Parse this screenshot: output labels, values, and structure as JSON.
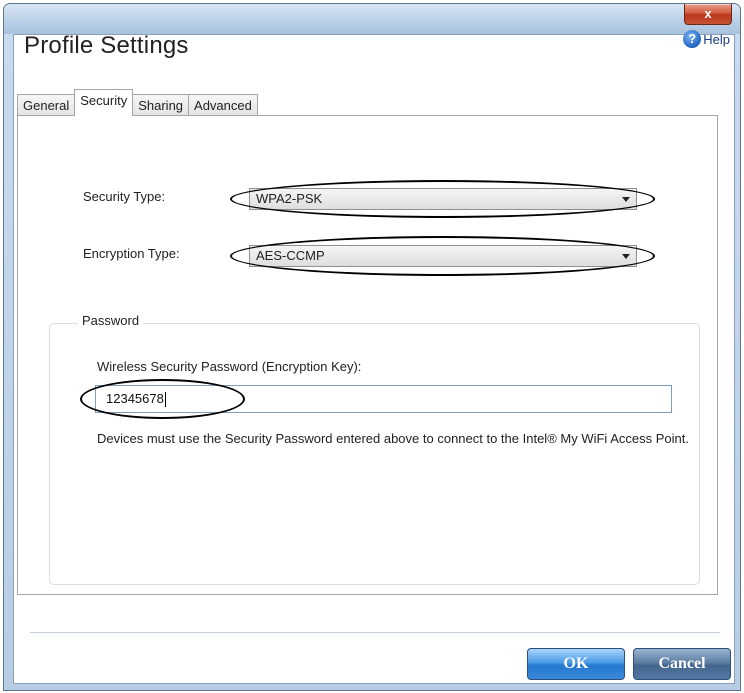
{
  "window": {
    "close_glyph": "x"
  },
  "header": {
    "title": "Profile Settings",
    "help_label": "Help",
    "help_icon": "help-icon"
  },
  "tabs": [
    {
      "label": "General",
      "selected": false
    },
    {
      "label": "Security",
      "selected": true
    },
    {
      "label": "Sharing",
      "selected": false
    },
    {
      "label": "Advanced",
      "selected": false
    }
  ],
  "security": {
    "security_type_label": "Security Type:",
    "security_type_value": "WPA2-PSK",
    "encryption_type_label": "Encryption Type:",
    "encryption_type_value": "AES-CCMP"
  },
  "password": {
    "group_label": "Password",
    "field_label": "Wireless Security Password (Encryption Key):",
    "value": "12345678",
    "note": "Devices must use the Security Password entered above to connect to the Intel® My WiFi Access Point."
  },
  "footer": {
    "ok_label": "OK",
    "cancel_label": "Cancel"
  },
  "colors": {
    "ok_blue": "#2476cf",
    "cancel_blue": "#42658e",
    "close_red": "#c95535"
  }
}
